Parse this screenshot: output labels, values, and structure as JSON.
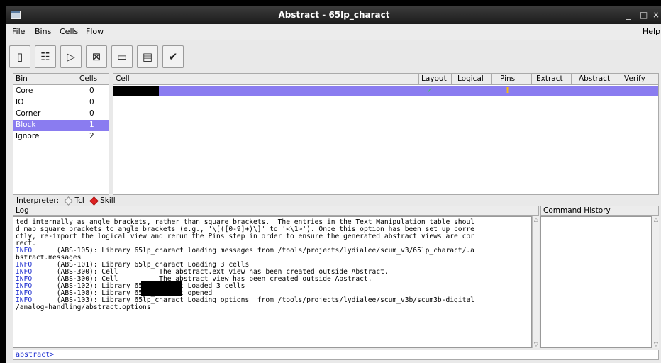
{
  "window": {
    "title": "Abstract - 65lp_charact",
    "minimize": "_",
    "maximize": "□",
    "close": "×"
  },
  "menubar": {
    "file": "File",
    "bins": "Bins",
    "cells": "Cells",
    "flow": "Flow",
    "help": "Help"
  },
  "toolbar": [
    {
      "icon": "open-library-icon",
      "glyph": "▯"
    },
    {
      "icon": "bins-icon",
      "glyph": "☷"
    },
    {
      "icon": "buffer-gate-icon",
      "glyph": "▷"
    },
    {
      "icon": "boxed-x-icon",
      "glyph": "⊠"
    },
    {
      "icon": "pins-icon",
      "glyph": "▭"
    },
    {
      "icon": "layers-icon",
      "glyph": "▤"
    },
    {
      "icon": "verify-check-icon",
      "glyph": "✔"
    }
  ],
  "bins": {
    "headers": {
      "bin": "Bin",
      "cells": "Cells"
    },
    "rows": [
      {
        "name": "Core",
        "count": "0"
      },
      {
        "name": "IO",
        "count": "0"
      },
      {
        "name": "Corner",
        "count": "0"
      },
      {
        "name": "Block",
        "count": "1"
      },
      {
        "name": "Ignore",
        "count": "2"
      }
    ]
  },
  "cells": {
    "headers": {
      "cell": "Cell",
      "layout": "Layout",
      "logical": "Logical",
      "pins": "Pins",
      "extract": "Extract",
      "abstract": "Abstract",
      "verify": "Verify"
    },
    "row": {
      "layout_status": "✓",
      "pins_status": "!"
    }
  },
  "interpreter": {
    "label": "Interpreter:",
    "tcl": "Tcl",
    "skill": "Skill",
    "selected": "Skill"
  },
  "log": {
    "header": "Log",
    "history_header": "Command History",
    "lines": [
      {
        "tag": "",
        "text": "ted internally as angle brackets, rather than square brackets.  The entries in the Text Manipulation table shoul"
      },
      {
        "tag": "",
        "text": "d map square brackets to angle brackets (e.g., '\\[([0-9]+)\\]' to '<\\1>'). Once this option has been set up corre"
      },
      {
        "tag": "",
        "text": "ctly, re-import the logical view and rerun the Pins step in order to ensure the generated abstract views are cor"
      },
      {
        "tag": "",
        "text": "rect."
      },
      {
        "tag": "INFO",
        "text": "      (ABS-105): Library 65lp_charact loading messages from /tools/projects/lydialee/scum_v3/65lp_charact/.a"
      },
      {
        "tag": "",
        "text": "bstract.messages"
      },
      {
        "tag": "INFO",
        "text": "      (ABS-101): Library 65lp_charact Loading 3 cells"
      },
      {
        "tag": "INFO",
        "text": "      (ABS-300): Cell          The abstract.ext view has been created outside Abstract."
      },
      {
        "tag": "INFO",
        "text": "      (ABS-300): Cell          The abstract view has been created outside Abstract."
      },
      {
        "tag": "INFO",
        "text": "      (ABS-102): Library 65lp_charact Loaded 3 cells"
      },
      {
        "tag": "INFO",
        "text": "      (ABS-108): Library 65lp_charact opened"
      },
      {
        "tag": "INFO",
        "text": "      (ABS-103): Library 65lp_charact Loading options  from /tools/projects/lydialee/scum_v3b/scum3b-digital"
      },
      {
        "tag": "",
        "text": "/analog-handling/abstract.options"
      }
    ]
  },
  "command": {
    "prompt": "abstract>"
  }
}
